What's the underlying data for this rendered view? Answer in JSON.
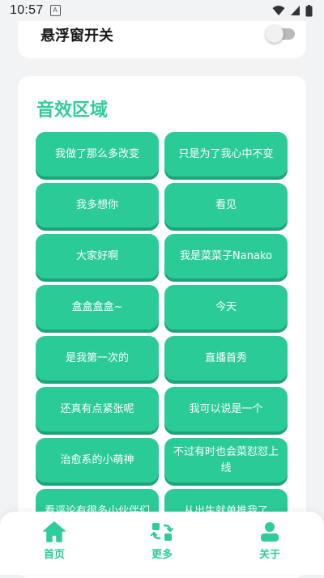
{
  "status_bar": {
    "time": "10:57",
    "sim_label": "A"
  },
  "settings": {
    "floating_window_label": "悬浮窗开关",
    "floating_window_on": false
  },
  "sounds": {
    "title": "音效区域",
    "items": [
      "我做了那么多改变",
      "只是为了我心中不变",
      "我多想你",
      "看见",
      "大家好啊",
      "我是菜菜子Nanako",
      "盒盒盒盒~",
      "今天",
      "是我第一次的",
      "直播首秀",
      "还真有点紧张呢",
      "我可以说是一个",
      "治愈系的小萌神",
      "不过有时也会菜怼怼上线",
      "看评论有很多小伙伴们",
      "从出生就单推我了"
    ]
  },
  "nav": {
    "home": "首页",
    "more": "更多",
    "about": "关于"
  },
  "colors": {
    "accent": "#2ecc9b",
    "button": "#2bcb98",
    "button_shadow": "#1ea47a"
  }
}
